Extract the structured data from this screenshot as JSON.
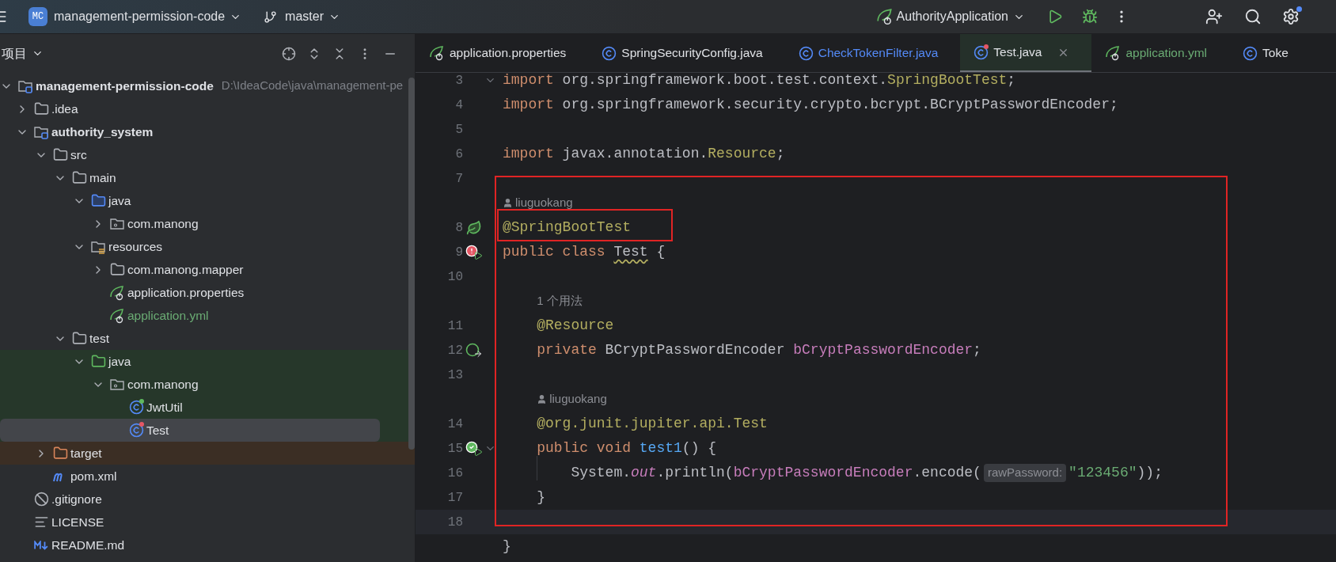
{
  "toolbar": {
    "project_badge": "MC",
    "project_name": "management-permission-code",
    "branch": "master",
    "run_config": "AuthorityApplication"
  },
  "sidebar": {
    "title": "项目",
    "tree": [
      {
        "label": "management-permission-code",
        "path": "D:\\IdeaCode\\java\\management-pe",
        "kind": "module",
        "expanded": true,
        "selected": false,
        "children": [
          {
            "label": ".idea",
            "kind": "folder",
            "expanded": false,
            "selected": false
          },
          {
            "label": "authority_system",
            "kind": "module",
            "expanded": true,
            "selected": false,
            "children": [
              {
                "label": "src",
                "kind": "folder",
                "expanded": true,
                "selected": false,
                "children": [
                  {
                    "label": "main",
                    "kind": "folder",
                    "expanded": true,
                    "selected": false,
                    "children": [
                      {
                        "label": "java",
                        "kind": "source",
                        "expanded": true,
                        "selected": false,
                        "children": [
                          {
                            "label": "com.manong",
                            "kind": "package",
                            "expanded": false,
                            "selected": false
                          }
                        ]
                      },
                      {
                        "label": "resources",
                        "kind": "resources",
                        "expanded": true,
                        "selected": false,
                        "children": [
                          {
                            "label": "com.manong.mapper",
                            "kind": "folder",
                            "expanded": false,
                            "selected": false
                          },
                          {
                            "label": "application.properties",
                            "kind": "spring",
                            "selected": false
                          },
                          {
                            "label": "application.yml",
                            "kind": "spring",
                            "selected": false,
                            "color": "#6aab73"
                          }
                        ]
                      }
                    ]
                  },
                  {
                    "label": "test",
                    "kind": "folder",
                    "expanded": true,
                    "selected": false,
                    "children": [
                      {
                        "label": "java",
                        "kind": "test-source",
                        "expanded": true,
                        "selected": false,
                        "children": [
                          {
                            "label": "com.manong",
                            "kind": "package",
                            "expanded": true,
                            "selected": false,
                            "children": [
                              {
                                "label": "JwtUtil",
                                "kind": "class-ok",
                                "selected": false
                              },
                              {
                                "label": "Test",
                                "kind": "class-error",
                                "selected": true
                              }
                            ]
                          }
                        ]
                      }
                    ]
                  }
                ]
              },
              {
                "label": "target",
                "kind": "excluded",
                "expanded": false,
                "selected": false
              },
              {
                "label": "pom.xml",
                "kind": "maven",
                "selected": false
              }
            ]
          },
          {
            "label": ".gitignore",
            "kind": "ignore",
            "selected": false
          },
          {
            "label": "LICENSE",
            "kind": "license",
            "selected": false
          },
          {
            "label": "README.md",
            "kind": "markdown",
            "selected": false
          }
        ]
      }
    ]
  },
  "tabs": [
    {
      "label": "application.properties",
      "kind": "spring",
      "selected": false,
      "color": "#dfe1e5"
    },
    {
      "label": "SpringSecurityConfig.java",
      "kind": "class",
      "selected": false,
      "color": "#dfe1e5"
    },
    {
      "label": "CheckTokenFilter.java",
      "kind": "class",
      "selected": false,
      "color": "#548af7"
    },
    {
      "label": "Test.java",
      "kind": "class-error",
      "selected": true,
      "color": "#dfe1e5"
    },
    {
      "label": "application.yml",
      "kind": "spring",
      "selected": false,
      "color": "#6aab73"
    },
    {
      "label": "Toke",
      "kind": "class",
      "selected": false,
      "color": "#dfe1e5"
    }
  ],
  "editor": {
    "rows": [
      {
        "kind": "code",
        "number": "3",
        "fold": true,
        "current": false,
        "tokens": [
          {
            "text": "import",
            "kind": "keyword"
          },
          {
            "text": " org.springframework.boot.test.context.",
            "kind": "plain"
          },
          {
            "text": "SpringBootTest",
            "kind": "annotation"
          },
          {
            "text": ";",
            "kind": "plain"
          }
        ]
      },
      {
        "kind": "code",
        "number": "4",
        "fold": false,
        "current": false,
        "tokens": [
          {
            "text": "import",
            "kind": "keyword"
          },
          {
            "text": " org.springframework.security.crypto.bcrypt.BCryptPasswordEncoder;",
            "kind": "plain"
          }
        ]
      },
      {
        "kind": "code",
        "number": "5",
        "fold": false,
        "current": false
      },
      {
        "kind": "code",
        "number": "6",
        "fold": false,
        "current": false,
        "tokens": [
          {
            "text": "import",
            "kind": "keyword"
          },
          {
            "text": " javax.annotation.",
            "kind": "plain"
          },
          {
            "text": "Resource",
            "kind": "annotation"
          },
          {
            "text": ";",
            "kind": "plain"
          }
        ]
      },
      {
        "kind": "code",
        "number": "7",
        "fold": false,
        "current": false
      },
      {
        "kind": "author",
        "text": "liuguokang"
      },
      {
        "kind": "code",
        "number": "8",
        "fold": false,
        "current": false,
        "marker": {
          "kind": "spring"
        },
        "tokens": [
          {
            "text": "@SpringBootTest",
            "kind": "annotation"
          }
        ]
      },
      {
        "kind": "code",
        "number": "9",
        "fold": false,
        "current": false,
        "marker": {
          "kind": "error-run"
        },
        "tokens": [
          {
            "text": "public class ",
            "kind": "keyword"
          },
          {
            "text": "Test",
            "kind": "warning"
          },
          {
            "text": " {",
            "kind": "plain"
          }
        ],
        "children": [
          {
            "kind": "code",
            "number": "10",
            "fold": false,
            "current": false
          },
          {
            "kind": "usages",
            "text": "1 个用法"
          },
          {
            "kind": "code",
            "number": "11",
            "fold": false,
            "current": false,
            "tokens": [
              {
                "text": "@Resource",
                "kind": "annotation"
              }
            ]
          },
          {
            "kind": "code",
            "number": "12",
            "fold": false,
            "current": false,
            "marker": {
              "kind": "bean"
            },
            "tokens": [
              {
                "text": "private",
                "kind": "keyword"
              },
              {
                "text": " BCryptPasswordEncoder ",
                "kind": "plain"
              },
              {
                "text": "bCryptPasswordEncoder",
                "kind": "field"
              },
              {
                "text": ";",
                "kind": "plain"
              }
            ]
          },
          {
            "kind": "code",
            "number": "13",
            "fold": false,
            "current": false
          },
          {
            "kind": "author",
            "text": "liuguokang"
          },
          {
            "kind": "code",
            "number": "14",
            "fold": false,
            "current": false,
            "tokens": [
              {
                "text": "@org.junit.jupiter.api.",
                "kind": "annotation"
              },
              {
                "text": "Test",
                "kind": "annotation"
              }
            ]
          },
          {
            "kind": "code",
            "number": "15",
            "fold": true,
            "current": false,
            "marker": {
              "kind": "ok-run"
            },
            "tokens": [
              {
                "text": "public void ",
                "kind": "keyword"
              },
              {
                "text": "test1",
                "kind": "method"
              },
              {
                "text": "() {",
                "kind": "plain"
              }
            ],
            "children": [
              {
                "kind": "code",
                "number": "16",
                "fold": false,
                "current": false,
                "tokens": [
                  {
                    "text": "System.",
                    "kind": "plain"
                  },
                  {
                    "text": "out",
                    "kind": "static"
                  },
                  {
                    "text": ".println(",
                    "kind": "plain"
                  },
                  {
                    "text": "bCryptPasswordEncoder",
                    "kind": "field"
                  },
                  {
                    "text": ".encode(",
                    "kind": "plain"
                  },
                  {
                    "text": "rawPassword:",
                    "kind": "hint"
                  },
                  {
                    "text": "\"123456\"",
                    "kind": "string"
                  },
                  {
                    "text": "));",
                    "kind": "plain"
                  }
                ]
              }
            ]
          },
          {
            "kind": "code",
            "number": "17",
            "fold": false,
            "current": false,
            "tokens": [
              {
                "text": "}",
                "kind": "plain"
              }
            ]
          }
        ]
      },
      {
        "kind": "code",
        "number": "18",
        "fold": false,
        "current": true
      },
      {
        "kind": "code",
        "fold": false,
        "current": false,
        "tokens": [
          {
            "text": "}",
            "kind": "plain"
          }
        ]
      }
    ]
  }
}
